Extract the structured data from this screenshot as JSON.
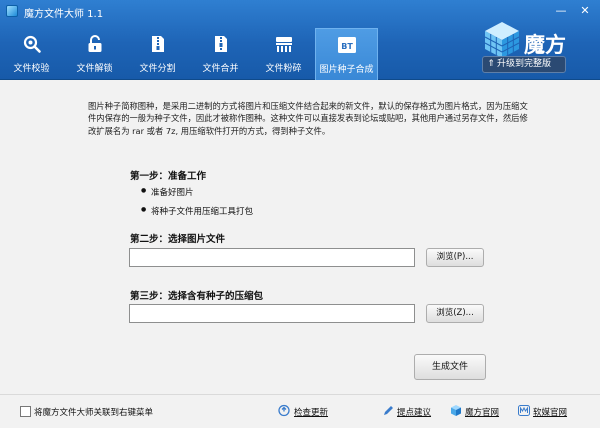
{
  "titlebar": {
    "title": "魔方文件大师 1.1",
    "min_label": "—",
    "close_label": "✕"
  },
  "tabs": [
    {
      "label": "文件校验",
      "icon": "magnifier-icon"
    },
    {
      "label": "文件解锁",
      "icon": "unlock-icon"
    },
    {
      "label": "文件分割",
      "icon": "zip-split-icon"
    },
    {
      "label": "文件合并",
      "icon": "zip-merge-icon"
    },
    {
      "label": "文件粉碎",
      "icon": "shredder-icon"
    },
    {
      "label": "图片种子合成",
      "icon": "bt-icon",
      "active": true,
      "badge": "BT"
    }
  ],
  "brand": {
    "name": "魔方",
    "upgrade_label": "升级到完整版"
  },
  "intro": "图片种子简称图种，是采用二进制的方式将图片和压缩文件结合起来的新文件，默认的保存格式为图片格式，因为压缩文件内保存的一般为种子文件，因此才被称作图种。这种文件可以直接发表到论坛或贴吧，其他用户通过另存文件，然后修改扩展名为 rar 或者 7z, 用压缩软件打开的方式，得到种子文件。",
  "step1": {
    "title": "第一步：准备工作",
    "items": [
      "准备好图片",
      "将种子文件用压缩工具打包"
    ]
  },
  "step2": {
    "title": "第二步：选择图片文件",
    "value": "",
    "browse_label": "浏览(P)..."
  },
  "step3": {
    "title": "第三步：选择含有种子的压缩包",
    "value": "",
    "browse_label": "浏览(Z)..."
  },
  "generate_label": "生成文件",
  "footer": {
    "checkbox_label": "将魔方文件大师关联到右键菜单",
    "checkbox_checked": false,
    "check_update": "检查更新",
    "feedback": "提点建议",
    "official_site": "魔方官网",
    "company_site": "软媒官网"
  },
  "colors": {
    "toolbar_blue": "#1e64b6",
    "active_tab": "#3988d6",
    "background": "#f2f2f2"
  }
}
